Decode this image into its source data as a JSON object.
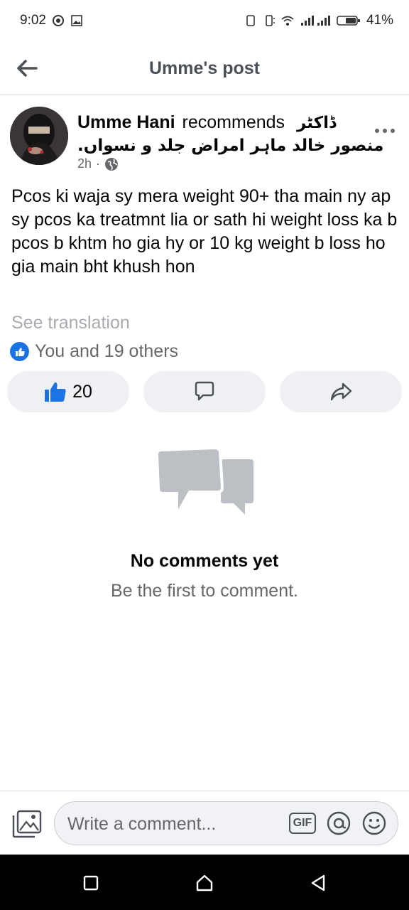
{
  "status_bar": {
    "time": "9:02",
    "battery": "41%"
  },
  "header": {
    "title": "Umme's post"
  },
  "post": {
    "author": "Umme Hani",
    "verb": "recommends",
    "recommended_urdu_1": "ڈاکٹر",
    "recommended_urdu_2": "منصور خالد ماہر امراض جلد و نسواں.",
    "time": "2h",
    "body": "Pcos ki waja sy mera weight 90+ tha main ny ap sy pcos ka treatmnt lia or sath hi weight loss ka b\npcos b khtm ho gia hy or 10 kg weight b loss ho gia main bht khush hon",
    "see_translation": "See translation",
    "reactions_text": "You and 19 others",
    "like_count": "20"
  },
  "comments": {
    "empty_title": "No comments yet",
    "empty_subtitle": "Be the first to comment."
  },
  "composer": {
    "placeholder": "Write a comment...",
    "gif_label": "GIF"
  },
  "colors": {
    "brand_blue": "#1b74e4",
    "icon_gray": "#bcc0c4",
    "text_gray": "#65676b"
  }
}
